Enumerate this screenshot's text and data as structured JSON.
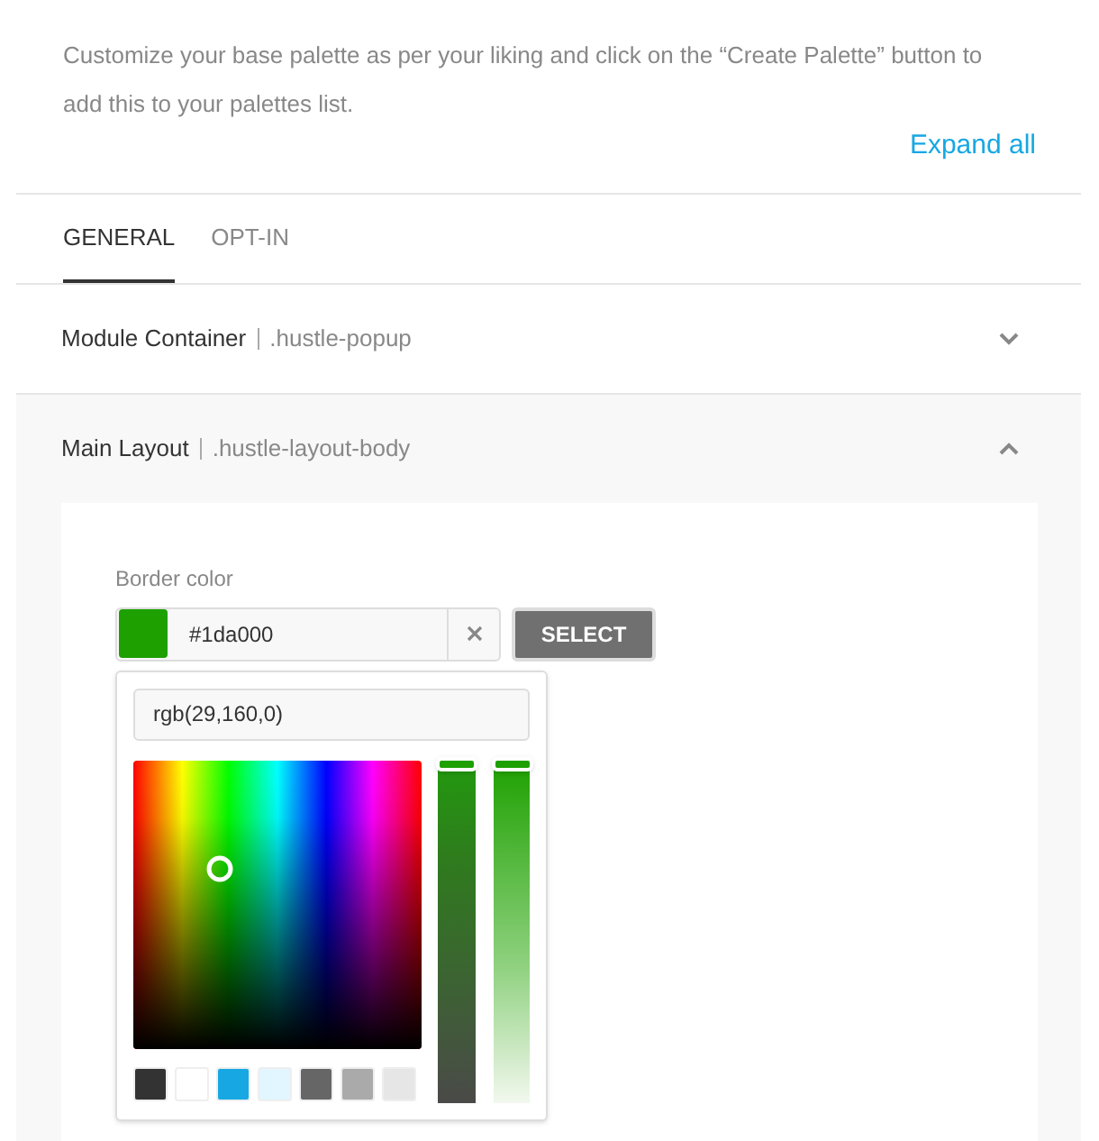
{
  "intro": "Customize your base palette as per your liking and click on the “Create Palette” button to add this to your palettes list.",
  "expand_all": "Expand all",
  "tabs": [
    {
      "label": "GENERAL",
      "selected": true
    },
    {
      "label": "OPT-IN",
      "selected": false
    }
  ],
  "sections": [
    {
      "title": "Module Container",
      "selector": ".hustle-popup",
      "expanded": false
    },
    {
      "title": "Main Layout",
      "selector": ".hustle-layout-body",
      "expanded": true
    }
  ],
  "field": {
    "label": "Border color",
    "value": "#1da000",
    "color": "#1da000",
    "select_button": "SELECT"
  },
  "picker": {
    "rgb": "rgb(29,160,0)",
    "lightness": {
      "level": 1
    },
    "alpha": {
      "level": 1
    },
    "swatches": [
      {
        "color": "#333333"
      },
      {
        "color": "#ffffff"
      },
      {
        "color": "#17a8e3"
      },
      {
        "color": "#e1f6ff"
      },
      {
        "color": "#666666"
      },
      {
        "color": "#aaaaaa"
      },
      {
        "color": "#e6e6e6"
      }
    ]
  }
}
